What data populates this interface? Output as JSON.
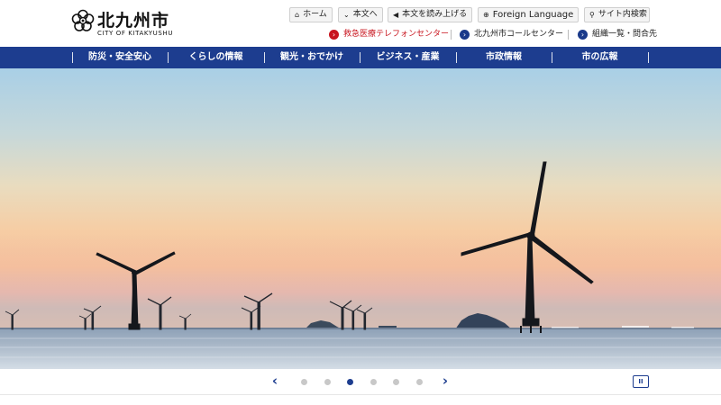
{
  "logo": {
    "title": "北九州市",
    "subtitle": "CITY OF KITAKYUSHU"
  },
  "utility": [
    {
      "icon": "home-icon",
      "glyph": "⌂",
      "label": "ホーム"
    },
    {
      "icon": "skip-down-icon",
      "glyph": "⌄",
      "label": "本文へ"
    },
    {
      "icon": "speaker-icon",
      "glyph": "◀",
      "label": "本文を読み上げる"
    },
    {
      "icon": "globe-icon",
      "glyph": "⊕",
      "label": "Foreign Language"
    },
    {
      "icon": "search-icon",
      "glyph": "⚲",
      "label": "サイト内検索"
    }
  ],
  "sublinks": [
    {
      "label": "救急医療テレフォンセンター",
      "color": "#c8141e"
    },
    {
      "label": "北九州市コールセンター",
      "color": "#1a3a8a"
    },
    {
      "label": "組織一覧・問合先",
      "color": "#1a3a8a"
    }
  ],
  "nav": [
    "防災・安全安心",
    "くらしの情報",
    "観光・おでかけ",
    "ビジネス・産業",
    "市政情報",
    "市の広報"
  ],
  "carousel": {
    "prev_glyph": "‹",
    "next_glyph": "›",
    "slide_count": 6,
    "active_index": 2,
    "pause_glyph": "II"
  },
  "colors": {
    "brand_blue": "#1d3d8f",
    "emergency_red": "#c8141e"
  }
}
